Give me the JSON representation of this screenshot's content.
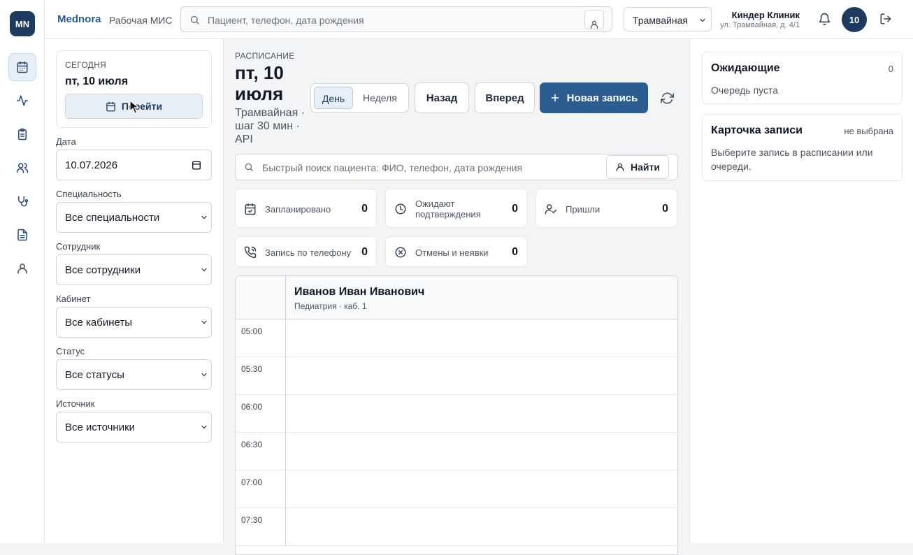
{
  "rail": {
    "logo": "MN",
    "items": [
      {
        "icon": "calendar-icon",
        "active": true
      },
      {
        "icon": "activity-icon",
        "active": false
      },
      {
        "icon": "clipboard-icon",
        "active": false
      },
      {
        "icon": "users-icon",
        "active": false
      },
      {
        "icon": "stethoscope-icon",
        "active": false
      },
      {
        "icon": "document-icon",
        "active": false
      },
      {
        "icon": "user-icon",
        "active": false
      }
    ]
  },
  "topbar": {
    "brand": "Mednora",
    "brand_sub": "Рабочая МИС",
    "search_placeholder": "Пациент, телефон, дата рождения",
    "branch": "Трамвайная",
    "clinic_name": "Киндер Клиник",
    "clinic_address": "ул. Трамвайная, д. 4/1",
    "avatar": "10"
  },
  "left": {
    "today_label": "СЕГОДНЯ",
    "today_date": "пт, 10 июля",
    "go_label": "Перейти",
    "filters": [
      {
        "label": "Дата",
        "value": "10.07.2026",
        "kind": "date"
      },
      {
        "label": "Специальность",
        "value": "Все специальности",
        "kind": "select"
      },
      {
        "label": "Сотрудник",
        "value": "Все сотрудники",
        "kind": "select"
      },
      {
        "label": "Кабинет",
        "value": "Все кабинеты",
        "kind": "select"
      },
      {
        "label": "Статус",
        "value": "Все статусы",
        "kind": "select"
      },
      {
        "label": "Источник",
        "value": "Все источники",
        "kind": "select"
      }
    ]
  },
  "main": {
    "eyebrow": "РАСПИСАНИЕ",
    "title": "пт, 10 июля",
    "subtitle": "Трамвайная · шаг 30 мин · API",
    "view_day": "День",
    "view_week": "Неделя",
    "back": "Назад",
    "forward": "Вперед",
    "new_record": "Новая запись",
    "quick_search_placeholder": "Быстрый поиск пациента: ФИО, телефон, дата рождения",
    "find": "Найти",
    "stats": [
      {
        "icon": "calendar-check-icon",
        "label": "Запланировано",
        "value": "0"
      },
      {
        "icon": "clock-icon",
        "label": "Ожидают подтверждения",
        "value": "0"
      },
      {
        "icon": "user-check-icon",
        "label": "Пришли",
        "value": "0"
      },
      {
        "icon": "phone-call-icon",
        "label": "Запись по телефону",
        "value": "0"
      },
      {
        "icon": "cancel-circle-icon",
        "label": "Отмены и неявки",
        "value": "0"
      }
    ],
    "doctor_name": "Иванов Иван Иванович",
    "doctor_detail": "Педиатрия · каб. 1",
    "times": [
      "05:00",
      "05:30",
      "06:00",
      "06:30",
      "07:00",
      "07:30"
    ]
  },
  "right": {
    "waiting_title": "Ожидающие",
    "waiting_count": "0",
    "waiting_empty": "Очередь пуста",
    "card_title": "Карточка записи",
    "card_status": "не выбрана",
    "card_hint": "Выберите запись в расписании или очереди."
  },
  "colors": {
    "accent": "#2b5d91",
    "dark": "#1e3a5f"
  }
}
